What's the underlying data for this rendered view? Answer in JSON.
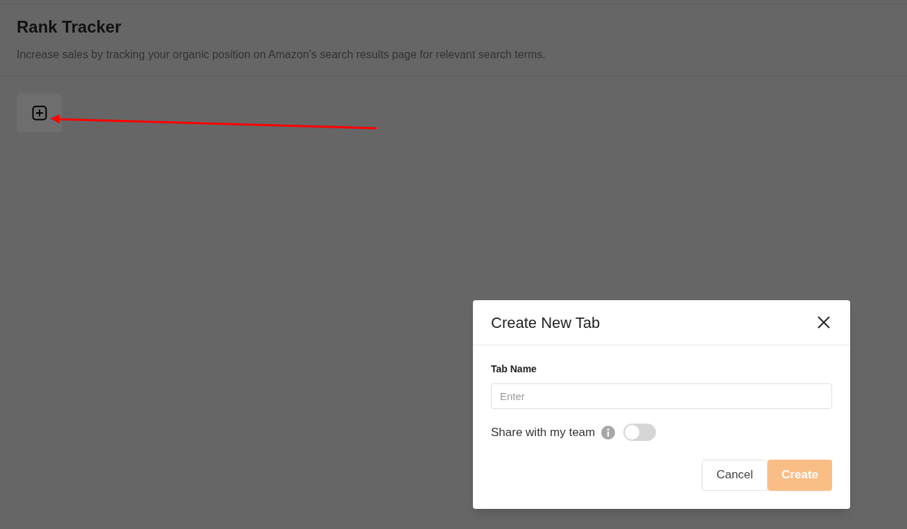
{
  "page": {
    "title": "Rank Tracker",
    "description": "Increase sales by tracking your organic position on Amazon’s search results page for relevant search terms."
  },
  "dialog": {
    "title": "Create New Tab",
    "field": {
      "label": "Tab Name",
      "placeholder": "Enter"
    },
    "share": {
      "label": "Share with my team",
      "on": false
    },
    "buttons": [
      {
        "label": "Cancel",
        "kind": "secondary",
        "disabled": false
      },
      {
        "label": "Create",
        "kind": "primary",
        "disabled": true
      }
    ]
  }
}
